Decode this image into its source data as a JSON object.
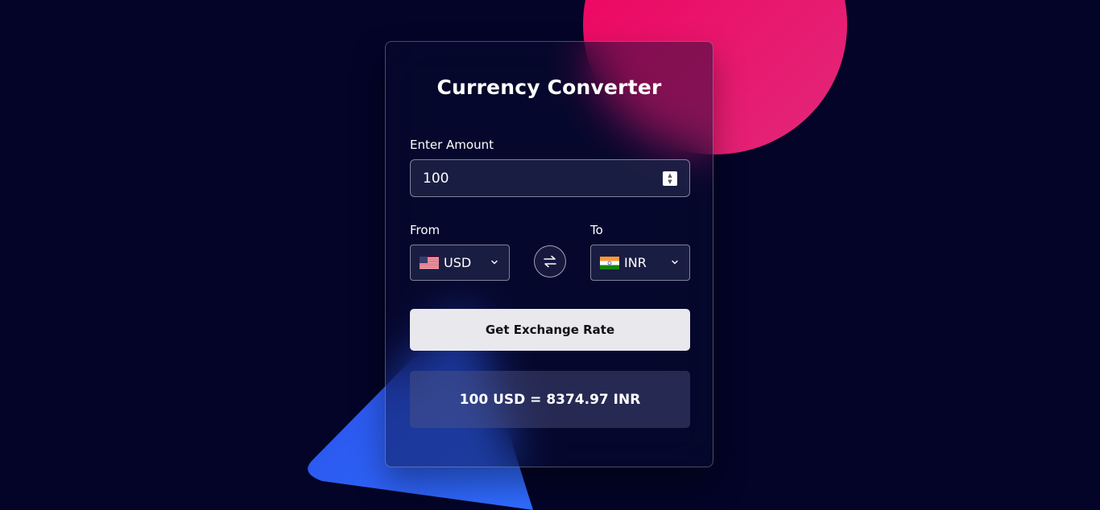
{
  "app": {
    "title": "Currency Converter"
  },
  "amount": {
    "label": "Enter Amount",
    "value": "100"
  },
  "from": {
    "label": "From",
    "currency": "USD",
    "flag_icon": "us-flag-icon"
  },
  "to": {
    "label": "To",
    "currency": "INR",
    "flag_icon": "india-flag-icon"
  },
  "swap": {
    "icon": "swap-arrows-icon"
  },
  "action": {
    "button_label": "Get Exchange Rate"
  },
  "result": {
    "text": "100 USD = 8374.97 INR"
  },
  "colors": {
    "background": "#030427",
    "circle": "#f0005e",
    "triangle": "#2a5cf5",
    "button": "#e9e8ed"
  }
}
